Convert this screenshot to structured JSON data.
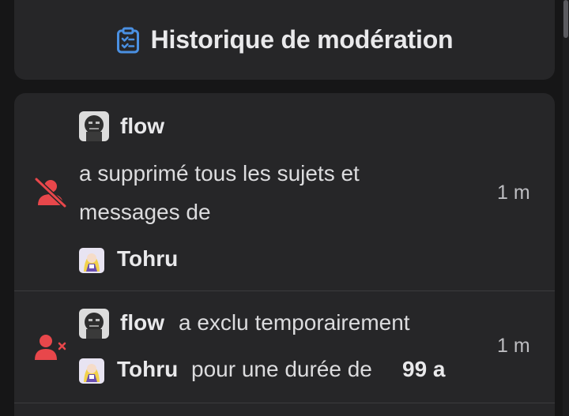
{
  "header": {
    "title": "Historique de modération",
    "icon": "clipboard-list-icon",
    "icon_color": "#4a90e2"
  },
  "entries": [
    {
      "action_icon": "user-slash-icon",
      "action_color": "#e8474b",
      "moderator": "flow",
      "text_line1": "a supprimé tous les sujets et",
      "text_line2": "messages de",
      "target": "Tohru",
      "time": "1 m"
    },
    {
      "action_icon": "user-ban-icon",
      "action_color": "#e8474b",
      "moderator": "flow",
      "action_text": "a exclu temporairement",
      "target": "Tohru",
      "duration_text": "pour une durée de",
      "duration_value": "99 a",
      "time": "1 m"
    }
  ]
}
